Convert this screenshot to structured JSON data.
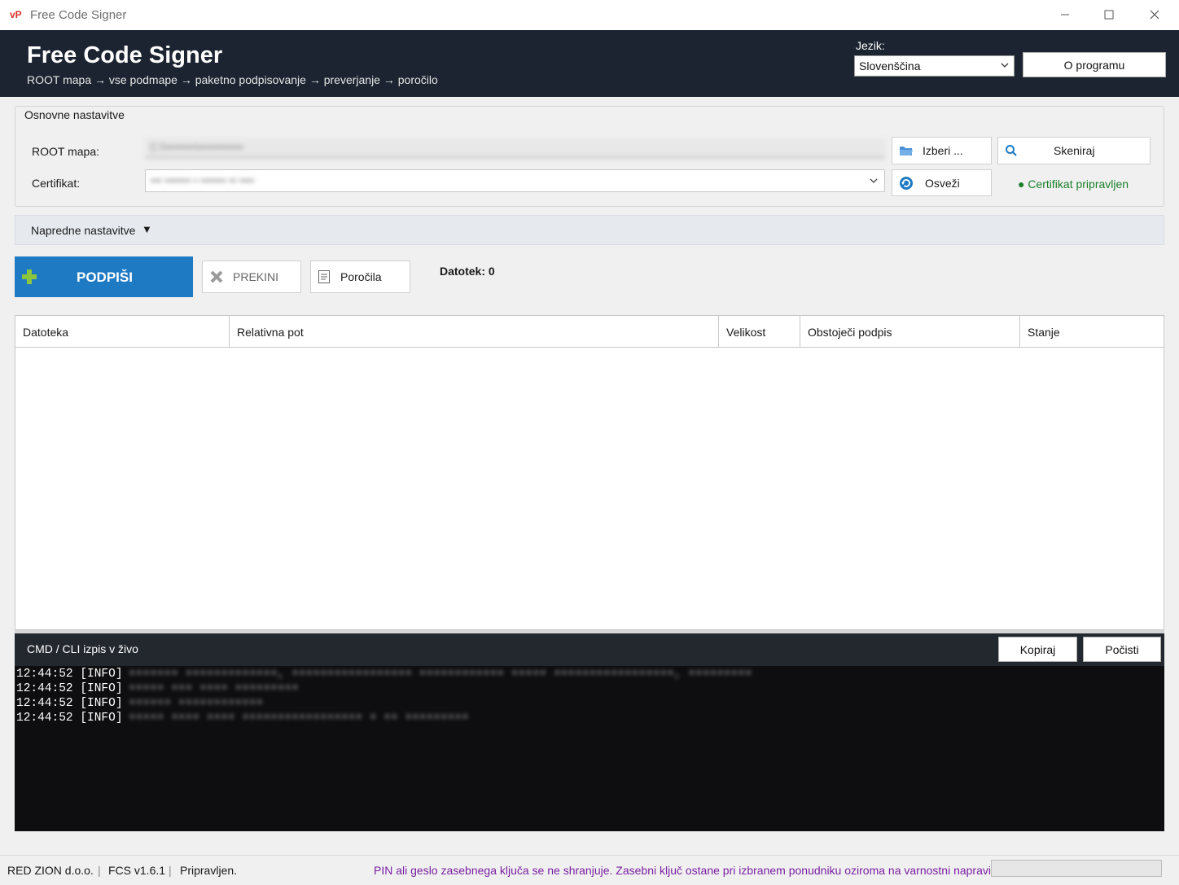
{
  "window": {
    "app_icon": "vP",
    "title": "Free Code Signer"
  },
  "header": {
    "title": "Free Code Signer",
    "subtitle": "ROOT mapa → vse podmape → paketno podpisovanje → preverjanje → poročilo",
    "language_label": "Jezik:",
    "language_value": "Slovenščina",
    "about_button": "O programu"
  },
  "basic_settings": {
    "legend": "Osnovne nastavitve",
    "root_label": "ROOT mapa:",
    "root_value": "C:\\\\••••••••\\••••••••••••",
    "cert_label": "Certifikat:",
    "cert_value": "••• ••••••• • ••••••• •• ••••",
    "choose_button": "Izberi ...",
    "scan_button": "Skeniraj",
    "refresh_button": "Osveži",
    "cert_status": "● Certifikat pripravljen"
  },
  "advanced": {
    "label": "Napredne nastavitve",
    "arrow": "▼"
  },
  "actions": {
    "sign_button": "PODPIŠI",
    "stop_button": "PREKINI",
    "reports_button": "Poročila",
    "file_count": "Datotek: 0"
  },
  "table": {
    "columns": [
      "Datoteka",
      "Relativna pot",
      "Velikost",
      "Obstoječi podpis",
      "Stanje"
    ],
    "rows": []
  },
  "console": {
    "title": "CMD / CLI izpis v živo",
    "copy_button": "Kopiraj",
    "clear_button": "Počisti",
    "lines": [
      {
        "time": "12:44:52 [INFO]",
        "message": "••••••• •••••••••••••, ••••••••••••••••• •••••••••••• ••••• •••••••••••••••••, •••••••••"
      },
      {
        "time": "12:44:52 [INFO]",
        "message": "••••• ••• •••• •••••••••"
      },
      {
        "time": "12:44:52 [INFO]",
        "message": "•••••• ••••••••••••"
      },
      {
        "time": "12:44:52 [INFO]",
        "message": "••••• •••• •••• ••••••••••••••••• • •• •••••••••"
      }
    ]
  },
  "status": {
    "company": "RED ZION d.o.o.",
    "version": "FCS v1.6.1",
    "state": "Pripravljen.",
    "separator": "|",
    "notice": "PIN ali geslo zasebnega ključa se ne shranjuje. Zasebni ključ ostane pri izbranem ponudniku oziroma na varnostni napravi.",
    "progress": 0
  },
  "colors": {
    "accent": "#1f7ac4",
    "header_bg": "#1b2430",
    "ok_green": "#1a7f2a",
    "notice_purple": "#7a1fa2",
    "console_bg": "#0e0e10"
  }
}
